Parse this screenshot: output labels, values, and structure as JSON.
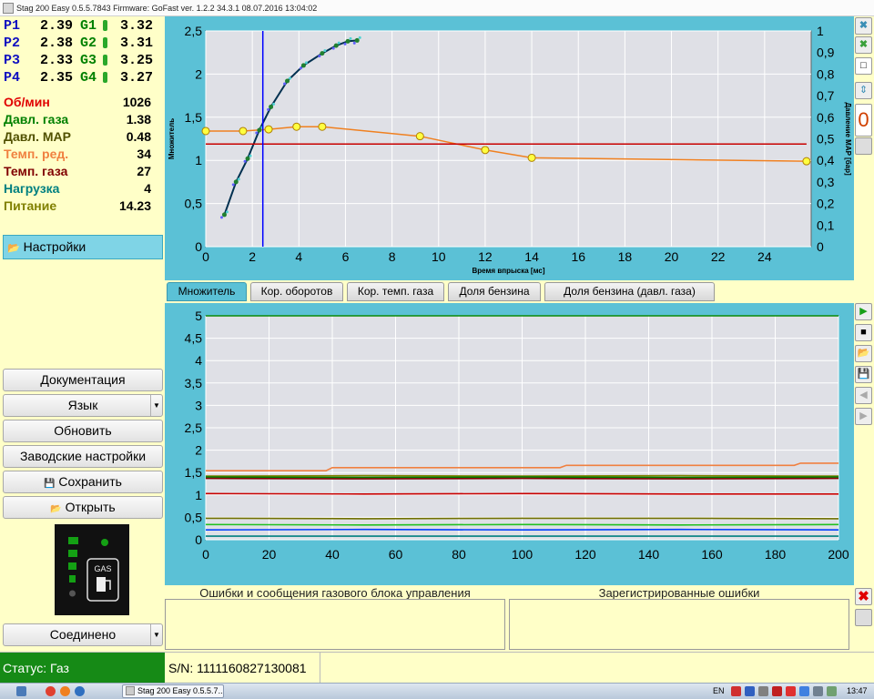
{
  "window": {
    "title": "Stag 200 Easy 0.5.5.7843 Firmware: GoFast  ver. 1.2.2  34.3.1  08.07.2016 13:04:02"
  },
  "injectors": [
    {
      "p_label": "P1",
      "p_value": "2.39",
      "g_label": "G1",
      "g_value": "3.32"
    },
    {
      "p_label": "P2",
      "p_value": "2.38",
      "g_label": "G2",
      "g_value": "3.31"
    },
    {
      "p_label": "P3",
      "p_value": "2.33",
      "g_label": "G3",
      "g_value": "3.25"
    },
    {
      "p_label": "P4",
      "p_value": "2.35",
      "g_label": "G4",
      "g_value": "3.27"
    }
  ],
  "params": [
    {
      "label": "Об/мин",
      "value": "1026",
      "color": "#e00000"
    },
    {
      "label": "Давл. газа",
      "value": "1.38",
      "color": "#008000"
    },
    {
      "label": "Давл. MAP",
      "value": "0.48",
      "color": "#505000"
    },
    {
      "label": "Темп. ред.",
      "value": "34",
      "color": "#f08040"
    },
    {
      "label": "Темп. газа",
      "value": "27",
      "color": "#800000"
    },
    {
      "label": "Нагрузка",
      "value": "4",
      "color": "#008080"
    },
    {
      "label": "Питание",
      "value": "14.23",
      "color": "#808000"
    }
  ],
  "sidebar": {
    "settings_label": "Настройки",
    "documentation_label": "Документация",
    "language_label": "Язык",
    "refresh_label": "Обновить",
    "factory_label": "Заводские настройки",
    "save_label": "Сохранить",
    "open_label": "Открыть",
    "connection_label": "Соединено",
    "gas_label": "GAS"
  },
  "tabs": [
    {
      "label": "Множитель",
      "active": true
    },
    {
      "label": "Кор. оборотов",
      "active": false
    },
    {
      "label": "Кор. темп. газа",
      "active": false
    },
    {
      "label": "Доля бензина",
      "active": false
    },
    {
      "label": "Доля бензина (давл. газа)",
      "active": false
    }
  ],
  "errors": {
    "left_title": "Ошибки и сообщения газового блока управления",
    "right_title": "Зарегистрированные ошибки"
  },
  "status": {
    "text": "Статус: Газ",
    "serial": "S/N: 1111160827130081"
  },
  "taskbar": {
    "app_label": "Stag 200 Easy 0.5.5.7...",
    "lang": "EN",
    "time": "13:47"
  },
  "chart_data": [
    {
      "type": "line",
      "xlabel": "Время впрыска [мс]",
      "ylabel": "Множитель",
      "y2label": "Давление MAP [бар]",
      "xlim": [
        0,
        26
      ],
      "ylim": [
        0,
        2.5
      ],
      "y2lim": [
        0,
        1
      ],
      "xticks": [
        "0",
        "2",
        "4",
        "6",
        "8",
        "10",
        "12",
        "14",
        "16",
        "18",
        "20",
        "22",
        "24"
      ],
      "yticks": [
        "0",
        "0,5",
        "1",
        "1,5",
        "2",
        "2,5"
      ],
      "y2ticks": [
        "0",
        "0,1",
        "0,2",
        "0,3",
        "0,4",
        "0,5",
        "0,6",
        "0,7",
        "0,8",
        "0,9",
        "1"
      ],
      "grid": true,
      "series": [
        {
          "color": "#f08020",
          "x": [
            0,
            1.6,
            2.7,
            3.9,
            5.0,
            9.2,
            12.0,
            14.0,
            25.8
          ],
          "y": [
            1.34,
            1.34,
            1.36,
            1.39,
            1.39,
            1.28,
            1.12,
            1.03,
            0.99
          ]
        },
        {
          "color": "#003050",
          "x": [
            0.8,
            1.3,
            1.8,
            2.3,
            2.8,
            3.5,
            4.2,
            5.0,
            5.6,
            6.1,
            6.5
          ],
          "y": [
            0.37,
            0.75,
            1.02,
            1.35,
            1.62,
            1.92,
            2.1,
            2.24,
            2.33,
            2.38,
            2.39
          ]
        },
        {
          "color": "#c80000",
          "x": [
            0,
            25.8
          ],
          "y": [
            1.19,
            1.19
          ]
        },
        {
          "color": "#0000ff",
          "x": [
            2.45,
            2.45
          ],
          "y": [
            0,
            2.5
          ]
        }
      ]
    },
    {
      "type": "line",
      "xlim": [
        0,
        200
      ],
      "ylim": [
        0,
        5
      ],
      "xticks": [
        "0",
        "20",
        "40",
        "60",
        "80",
        "100",
        "120",
        "140",
        "160",
        "180",
        "200"
      ],
      "yticks": [
        "0",
        "0,5",
        "1",
        "1,5",
        "2",
        "2,5",
        "3",
        "3,5",
        "4",
        "4,5",
        "5"
      ],
      "grid": true,
      "series": [
        {
          "color": "#0a8a0a",
          "x": [
            0,
            200
          ],
          "y": [
            5.0,
            5.0
          ]
        },
        {
          "color": "#f08040",
          "x": [
            0,
            38,
            40,
            112,
            114,
            186,
            188,
            200
          ],
          "y": [
            1.54,
            1.54,
            1.61,
            1.61,
            1.66,
            1.66,
            1.71,
            1.71
          ]
        },
        {
          "color": "#808000",
          "x": [
            0,
            50,
            100,
            150,
            200
          ],
          "y": [
            1.42,
            1.43,
            1.42,
            1.43,
            1.42
          ]
        },
        {
          "color": "#008000",
          "x": [
            0,
            50,
            100,
            150,
            200
          ],
          "y": [
            1.4,
            1.39,
            1.4,
            1.39,
            1.4
          ]
        },
        {
          "color": "#800000",
          "x": [
            0,
            50,
            100,
            150,
            200
          ],
          "y": [
            1.37,
            1.36,
            1.37,
            1.36,
            1.37
          ]
        },
        {
          "color": "#c80000",
          "x": [
            0,
            50,
            100,
            150,
            200
          ],
          "y": [
            1.03,
            1.02,
            1.03,
            1.02,
            1.02
          ]
        },
        {
          "color": "#707000",
          "x": [
            0,
            50,
            100,
            150,
            200
          ],
          "y": [
            0.48,
            0.47,
            0.48,
            0.48,
            0.47
          ]
        },
        {
          "color": "#20c020",
          "x": [
            0,
            50,
            100,
            150,
            200
          ],
          "y": [
            0.34,
            0.33,
            0.34,
            0.33,
            0.34
          ]
        },
        {
          "color": "#0040ff",
          "x": [
            0,
            50,
            100,
            150,
            200
          ],
          "y": [
            0.22,
            0.23,
            0.22,
            0.23,
            0.22
          ]
        },
        {
          "color": "#008080",
          "x": [
            0,
            50,
            100,
            150,
            200
          ],
          "y": [
            0.08,
            0.08,
            0.08,
            0.08,
            0.08
          ]
        }
      ]
    }
  ]
}
